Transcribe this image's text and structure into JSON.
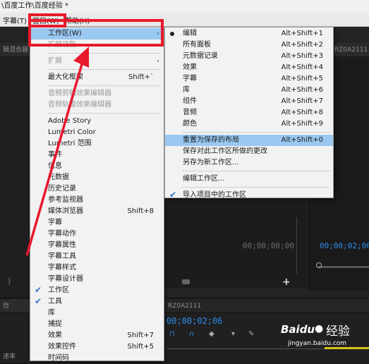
{
  "title": "\\百度工作\\百度经验 *",
  "menubar": {
    "subtitle": "字幕(T)",
    "window": "窗口(W)",
    "help": "帮助(H)"
  },
  "panels": {
    "mixer_label": "辑混合器",
    "source_timecode": "00;00;00;00",
    "program_timecode": "00;00;02;06",
    "program_tab": "RZ0A2111",
    "timeline_tab": "RZ0A2111",
    "timeline_timecode": "00;00;02;06",
    "lower_left_label": "信",
    "speed_label": "速率"
  },
  "window_menu": [
    {
      "label": "工作区(W)",
      "submenu": true,
      "highlighted": true
    },
    {
      "label": "扩展功能",
      "disabled": true
    },
    {
      "sep": true
    },
    {
      "label": "扩展",
      "disabled": true,
      "submenu": true
    },
    {
      "sep": true
    },
    {
      "label": "最大化框架",
      "shortcut": "Shift+`"
    },
    {
      "sep": true
    },
    {
      "label": "音频剪辑效果编辑器",
      "disabled": true
    },
    {
      "label": "音频轨道效果编辑器",
      "disabled": true
    },
    {
      "sep": true
    },
    {
      "label": "Adobe Story"
    },
    {
      "label": "Lumetri Color"
    },
    {
      "label": "Lumetri 范围"
    },
    {
      "label": "事件"
    },
    {
      "label": "信息"
    },
    {
      "label": "元数据"
    },
    {
      "label": "历史记录"
    },
    {
      "label": "参考监视器"
    },
    {
      "label": "媒体浏览器",
      "shortcut": "Shift+8"
    },
    {
      "label": "字幕"
    },
    {
      "label": "字幕动作"
    },
    {
      "label": "字幕属性"
    },
    {
      "label": "字幕工具"
    },
    {
      "label": "字幕样式"
    },
    {
      "label": "字幕设计器"
    },
    {
      "label": "工作区",
      "checked": true
    },
    {
      "label": "工具",
      "checked": true
    },
    {
      "label": "库"
    },
    {
      "label": "捕捉"
    },
    {
      "label": "效果",
      "shortcut": "Shift+7"
    },
    {
      "label": "效果控件",
      "shortcut": "Shift+5"
    },
    {
      "label": "时间码"
    }
  ],
  "workspace_menu": [
    {
      "label": "编辑",
      "shortcut": "Alt+Shift+1",
      "radio": true
    },
    {
      "label": "所有面板",
      "shortcut": "Alt+Shift+2"
    },
    {
      "label": "元数据记录",
      "shortcut": "Alt+Shift+3"
    },
    {
      "label": "效果",
      "shortcut": "Alt+Shift+4"
    },
    {
      "label": "字幕",
      "shortcut": "Alt+Shift+5"
    },
    {
      "label": "库",
      "shortcut": "Alt+Shift+6"
    },
    {
      "label": "组件",
      "shortcut": "Alt+Shift+7"
    },
    {
      "label": "音频",
      "shortcut": "Alt+Shift+8"
    },
    {
      "label": "颜色",
      "shortcut": "Alt+Shift+9"
    },
    {
      "sep": true
    },
    {
      "label": "重置为保存的布局",
      "shortcut": "Alt+Shift+0",
      "highlighted": true
    },
    {
      "label": "保存对此工作区所做的更改"
    },
    {
      "label": "另存为新工作区..."
    },
    {
      "sep": true
    },
    {
      "label": "编辑工作区..."
    },
    {
      "sep": true
    },
    {
      "label": "导入项目中的工作区",
      "checked": true
    }
  ],
  "watermark": {
    "brand": "Baidu",
    "text": "经验",
    "url": "jingyan.baidu.com"
  },
  "colors": {
    "highlight": "#99c8f0",
    "red_box": "#e8192c",
    "accent_blue": "#2d8ceb"
  }
}
